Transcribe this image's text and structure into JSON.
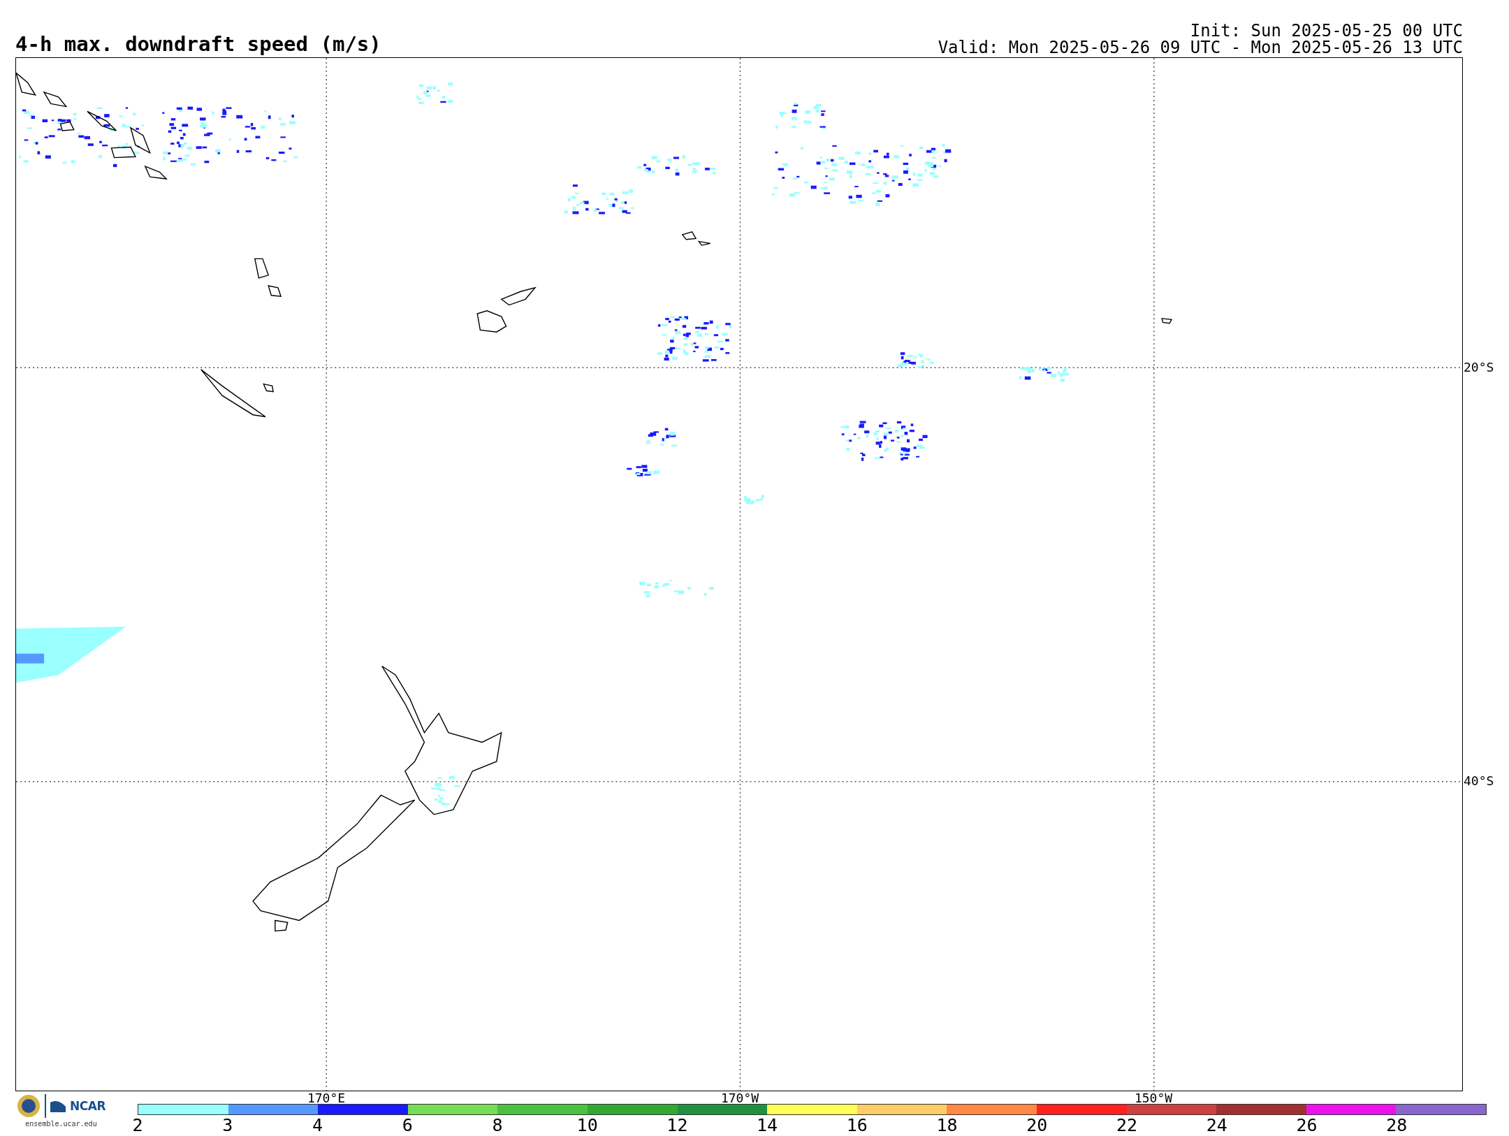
{
  "title": "4-h max. downdraft speed (m/s)",
  "init": "Init: Sun 2025-05-25 00 UTC",
  "valid": "Valid: Mon 2025-05-26 09 UTC - Mon 2025-05-26 13 UTC",
  "map": {
    "lat_labels": [
      "20°S",
      "40°S"
    ],
    "lon_labels": [
      "170°E",
      "170°W",
      "150°W"
    ]
  },
  "colorbar": {
    "segments": [
      {
        "color": "#99ffff"
      },
      {
        "color": "#5599ff"
      },
      {
        "color": "#1a1aff"
      },
      {
        "color": "#77dd55"
      },
      {
        "color": "#4cc040"
      },
      {
        "color": "#33a833"
      },
      {
        "color": "#229040"
      },
      {
        "color": "#ffff55"
      },
      {
        "color": "#ffcc66"
      },
      {
        "color": "#ff8844"
      },
      {
        "color": "#ff2020"
      },
      {
        "color": "#cc4040"
      },
      {
        "color": "#a03030"
      },
      {
        "color": "#ee11ee"
      },
      {
        "color": "#8866cc"
      }
    ],
    "tick_labels": [
      "2",
      "3",
      "4",
      "6",
      "8",
      "10",
      "12",
      "14",
      "16",
      "18",
      "20",
      "22",
      "24",
      "26",
      "28"
    ]
  },
  "logo": {
    "name": "NCAR",
    "url": "ensemble.ucar.edu"
  }
}
